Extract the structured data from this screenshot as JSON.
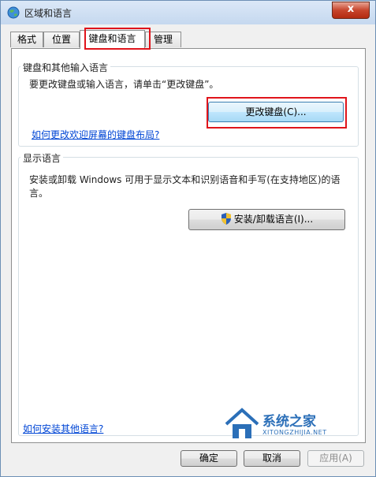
{
  "window": {
    "title": "区域和语言",
    "close_label": "x"
  },
  "tabs": [
    {
      "label": "格式"
    },
    {
      "label": "位置"
    },
    {
      "label": "键盘和语言"
    },
    {
      "label": "管理"
    }
  ],
  "keyboard_group": {
    "title": "键盘和其他输入语言",
    "description": "要更改键盘或输入语言，请单击“更改键盘”。",
    "change_button": "更改键盘(C)...",
    "welcome_link": "如何更改欢迎屏幕的键盘布局?"
  },
  "display_group": {
    "title": "显示语言",
    "description_line1": "安装或卸载 Windows 可用于显示文本和识别语音和手写(在支持地区)的语",
    "description_line2": "言。",
    "install_button": "安装/卸载语言(I)..."
  },
  "install_link": "如何安装其他语言?",
  "footer": {
    "ok": "确定",
    "cancel": "取消",
    "apply": "应用(A)"
  },
  "watermark": {
    "name": "系统之家",
    "url": "XITONGZHIJIA.NET"
  },
  "colors": {
    "highlight": "#e0141b",
    "link": "#0046d5"
  }
}
